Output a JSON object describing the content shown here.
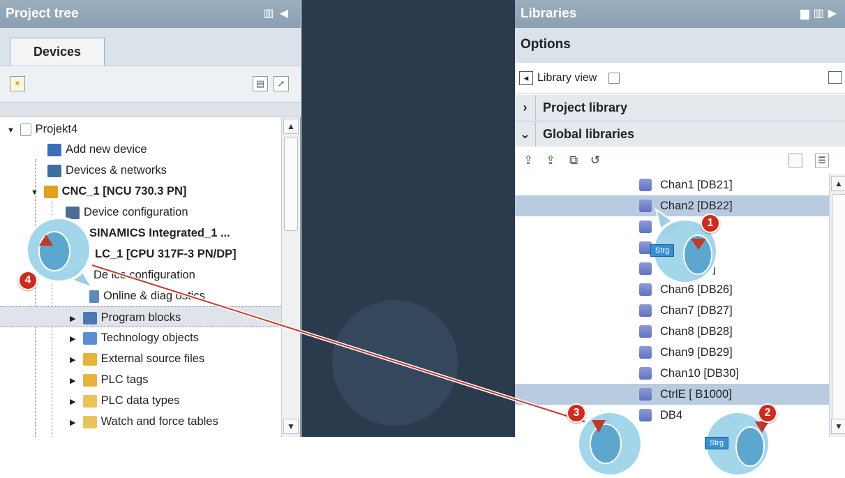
{
  "project_tree": {
    "title": "Project tree",
    "tab": "Devices",
    "items": [
      {
        "label": "Projekt4",
        "bold": false
      },
      {
        "label": "Add new device",
        "bold": false
      },
      {
        "label": "Devices & networks",
        "bold": false
      },
      {
        "label": "CNC_1 [NCU 730.3 PN]",
        "bold": true
      },
      {
        "label": "Device configuration",
        "bold": false
      },
      {
        "label": "SINAMICS Integrated_1 ...",
        "bold": true
      },
      {
        "label": "LC_1 [CPU 317F-3 PN/DP]",
        "bold": true
      },
      {
        "label": "De ice configuration",
        "bold": false
      },
      {
        "label": "Online & diag ostics",
        "bold": false
      },
      {
        "label": "Program blocks",
        "bold": false
      },
      {
        "label": "Technology objects",
        "bold": false
      },
      {
        "label": "External source files",
        "bold": false
      },
      {
        "label": "PLC tags",
        "bold": false
      },
      {
        "label": "PLC data types",
        "bold": false
      },
      {
        "label": "Watch and force tables",
        "bold": false
      }
    ]
  },
  "libraries": {
    "title": "Libraries",
    "options_label": "Options",
    "library_view_label": "Library view",
    "project_library_label": "Project library",
    "global_libraries_label": "Global libraries",
    "items": [
      {
        "label": "Chan1 [DB21]",
        "selected": false
      },
      {
        "label": "Chan2 [DB22]",
        "selected": true
      },
      {
        "label": "23]",
        "selected": true
      },
      {
        "label": "24]",
        "selected": true
      },
      {
        "label": "B25]",
        "selected": true
      },
      {
        "label": "Chan6 [DB26]",
        "selected": true
      },
      {
        "label": "Chan7 [DB27]",
        "selected": true
      },
      {
        "label": "Chan8 [DB28]",
        "selected": true
      },
      {
        "label": "Chan9 [DB29]",
        "selected": true
      },
      {
        "label": "Chan10 [DB30]",
        "selected": true
      },
      {
        "label": "CtrlE [ B1000]",
        "selected": true
      },
      {
        "label": "DB4",
        "selected": false
      }
    ]
  },
  "callouts": {
    "step1": "1",
    "step2": "2",
    "step3": "3",
    "step4": "4",
    "strg_label": "Strg"
  },
  "colors": {
    "titlebar": "#8fa4b5",
    "selection": "#b9cbe0",
    "dark_area": "#2b3b4e",
    "step_badge": "#cf2a1e",
    "drag_line": "#c0392b"
  }
}
